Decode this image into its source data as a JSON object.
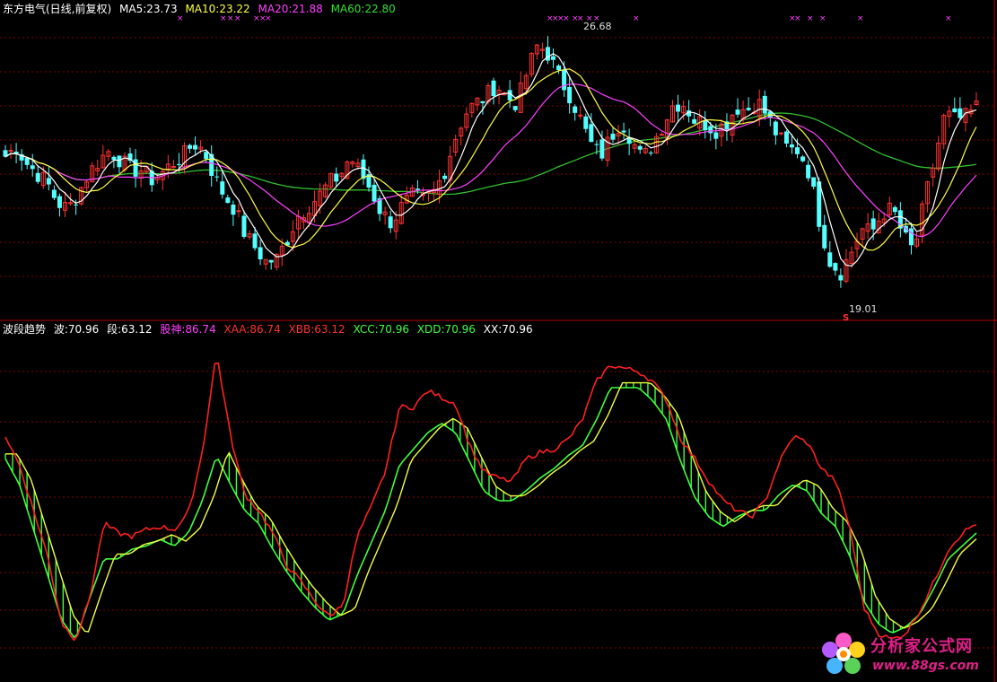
{
  "header_top": {
    "stock": "东方电气(日线,前复权)",
    "ma5": "MA5:23.73",
    "ma10": "MA10:23.22",
    "ma20": "MA20:21.88",
    "ma60": "MA60:22.80"
  },
  "header_bottom": {
    "name": "波段趋势",
    "bo": "波:70.96",
    "duan": "段:63.12",
    "gushen": "股神:86.74",
    "xaa": "XAA:86.74",
    "xbb": "XBB:63.12",
    "xcc": "XCC:70.96",
    "xdd": "XDD:70.96",
    "xx": "XX:70.96"
  },
  "annotations": {
    "high_label": "26.68",
    "low_label": "19.01",
    "low_marker": "S"
  },
  "watermark": {
    "title": "分析家公式网",
    "url": "www.88gs.com"
  },
  "colors": {
    "background": "#000000",
    "up_candle": "#ff3232",
    "down_candle": "#54ffff",
    "ma5": "#ffffff",
    "ma10": "#ffff40",
    "ma20": "#ff40ff",
    "ma60": "#30c030",
    "grid": "#800000",
    "line_red": "#ff2020",
    "line_green": "#40ff40",
    "line_yellow": "#f0ff40",
    "hist": "#40ff40"
  },
  "chart_data": [
    {
      "type": "candlestick",
      "title": "东方电气(日线,前复权)",
      "series": [
        {
          "name": "MA5",
          "value": 23.73
        },
        {
          "name": "MA10",
          "value": 23.22
        },
        {
          "name": "MA20",
          "value": 21.88
        },
        {
          "name": "MA60",
          "value": 22.8
        }
      ],
      "price_range": [
        18.5,
        27.2
      ],
      "annotations": [
        {
          "label": "26.68",
          "kind": "high"
        },
        {
          "label": "19.01",
          "kind": "low"
        }
      ],
      "close_path": [
        23.0,
        23.3,
        22.8,
        22.5,
        22.2,
        21.6,
        21.4,
        21.9,
        22.5,
        22.9,
        23.2,
        22.9,
        22.6,
        22.6,
        22.3,
        22.5,
        22.8,
        23.0,
        23.4,
        23.2,
        22.4,
        21.8,
        21.4,
        20.6,
        20.2,
        19.8,
        19.9,
        20.5,
        21.2,
        21.5,
        21.8,
        22.2,
        22.4,
        23.0,
        22.5,
        22.0,
        21.3,
        21.0,
        21.5,
        21.8,
        21.7,
        21.9,
        22.5,
        23.5,
        24.3,
        24.6,
        24.8,
        25.2,
        24.8,
        24.6,
        25.6,
        26.4,
        26.1,
        25.4,
        24.9,
        24.2,
        23.4,
        23.0,
        23.6,
        24.1,
        23.5,
        22.9,
        23.4,
        24.0,
        24.6,
        24.6,
        24.1,
        24.0,
        23.8,
        24.0,
        24.5,
        24.4,
        24.7,
        24.2,
        23.6,
        23.2,
        23.2,
        22.5,
        21.0,
        19.8,
        19.5,
        20.1,
        20.8,
        20.7,
        21.3,
        21.4,
        20.6,
        20.1,
        21.6,
        22.9,
        24.3,
        24.1,
        24.2,
        24.5
      ],
      "range": [
        18.5,
        27.2
      ]
    },
    {
      "type": "line",
      "title": "波段趋势",
      "series": [
        {
          "name": "XAA",
          "last": 86.74
        },
        {
          "name": "XBB",
          "last": 63.12
        },
        {
          "name": "XCC",
          "last": 70.96
        },
        {
          "name": "XDD",
          "last": 70.96
        },
        {
          "name": "XX",
          "last": 70.96
        }
      ],
      "red_path": [
        75,
        66,
        52,
        38,
        17,
        12,
        25,
        48,
        45,
        44,
        46,
        47,
        46,
        51,
        70,
        101,
        75,
        57,
        52,
        45,
        35,
        30,
        24,
        19,
        23,
        44,
        53,
        64,
        84,
        84,
        89,
        87,
        85,
        72,
        64,
        62,
        61,
        68,
        70,
        71,
        74,
        80,
        92,
        97,
        96,
        95,
        92,
        86,
        74,
        68,
        61,
        55,
        52,
        50,
        55,
        67,
        75,
        73,
        65,
        61,
        47,
        22,
        14,
        12,
        14,
        21,
        30,
        40,
        45,
        48
      ],
      "green_path": [
        68,
        60,
        46,
        32,
        18,
        12,
        25,
        37,
        37,
        40,
        41,
        43,
        41,
        45,
        55,
        69,
        60,
        52,
        48,
        40,
        33,
        27,
        22,
        18,
        20,
        32,
        42,
        52,
        66,
        71,
        76,
        79,
        76,
        67,
        58,
        55,
        55,
        58,
        62,
        65,
        69,
        72,
        80,
        90,
        90,
        90,
        86,
        80,
        67,
        56,
        50,
        47,
        50,
        52,
        52,
        57,
        60,
        58,
        51,
        47,
        38,
        24,
        17,
        14,
        16,
        20,
        28,
        37,
        41,
        45
      ],
      "range": [
        0,
        105
      ]
    }
  ]
}
